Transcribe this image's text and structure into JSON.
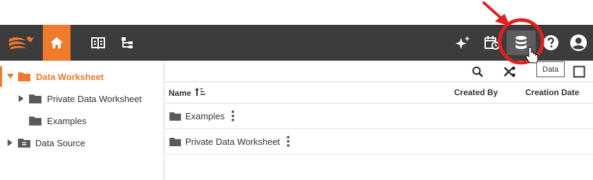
{
  "toolbar": {
    "icons": {
      "logo": "brand-logo-icon",
      "home": "home-icon",
      "book": "book-icon",
      "tree": "tree-icon",
      "sparkle": "sparkle-icon",
      "schedule": "schedule-icon",
      "data": "database-icon",
      "help": "help-icon",
      "user": "user-icon"
    },
    "data_tooltip": "Data"
  },
  "colors": {
    "toolbar_bg": "#3c3c3c",
    "accent": "#ef7a2c",
    "highlight_ring": "#e02020"
  },
  "tree": {
    "items": [
      {
        "label": "Data Worksheet",
        "expanded": true,
        "selected": true
      },
      {
        "label": "Private Data Worksheet",
        "expanded": false,
        "selected": false
      },
      {
        "label": "Examples",
        "expanded": false,
        "selected": false
      },
      {
        "label": "Data Source",
        "expanded": false,
        "selected": false
      }
    ]
  },
  "list": {
    "columns": {
      "name": "Name",
      "created_by": "Created By",
      "creation_date": "Creation Date"
    },
    "rows": [
      {
        "name": "Examples"
      },
      {
        "name": "Private Data Worksheet"
      }
    ]
  }
}
